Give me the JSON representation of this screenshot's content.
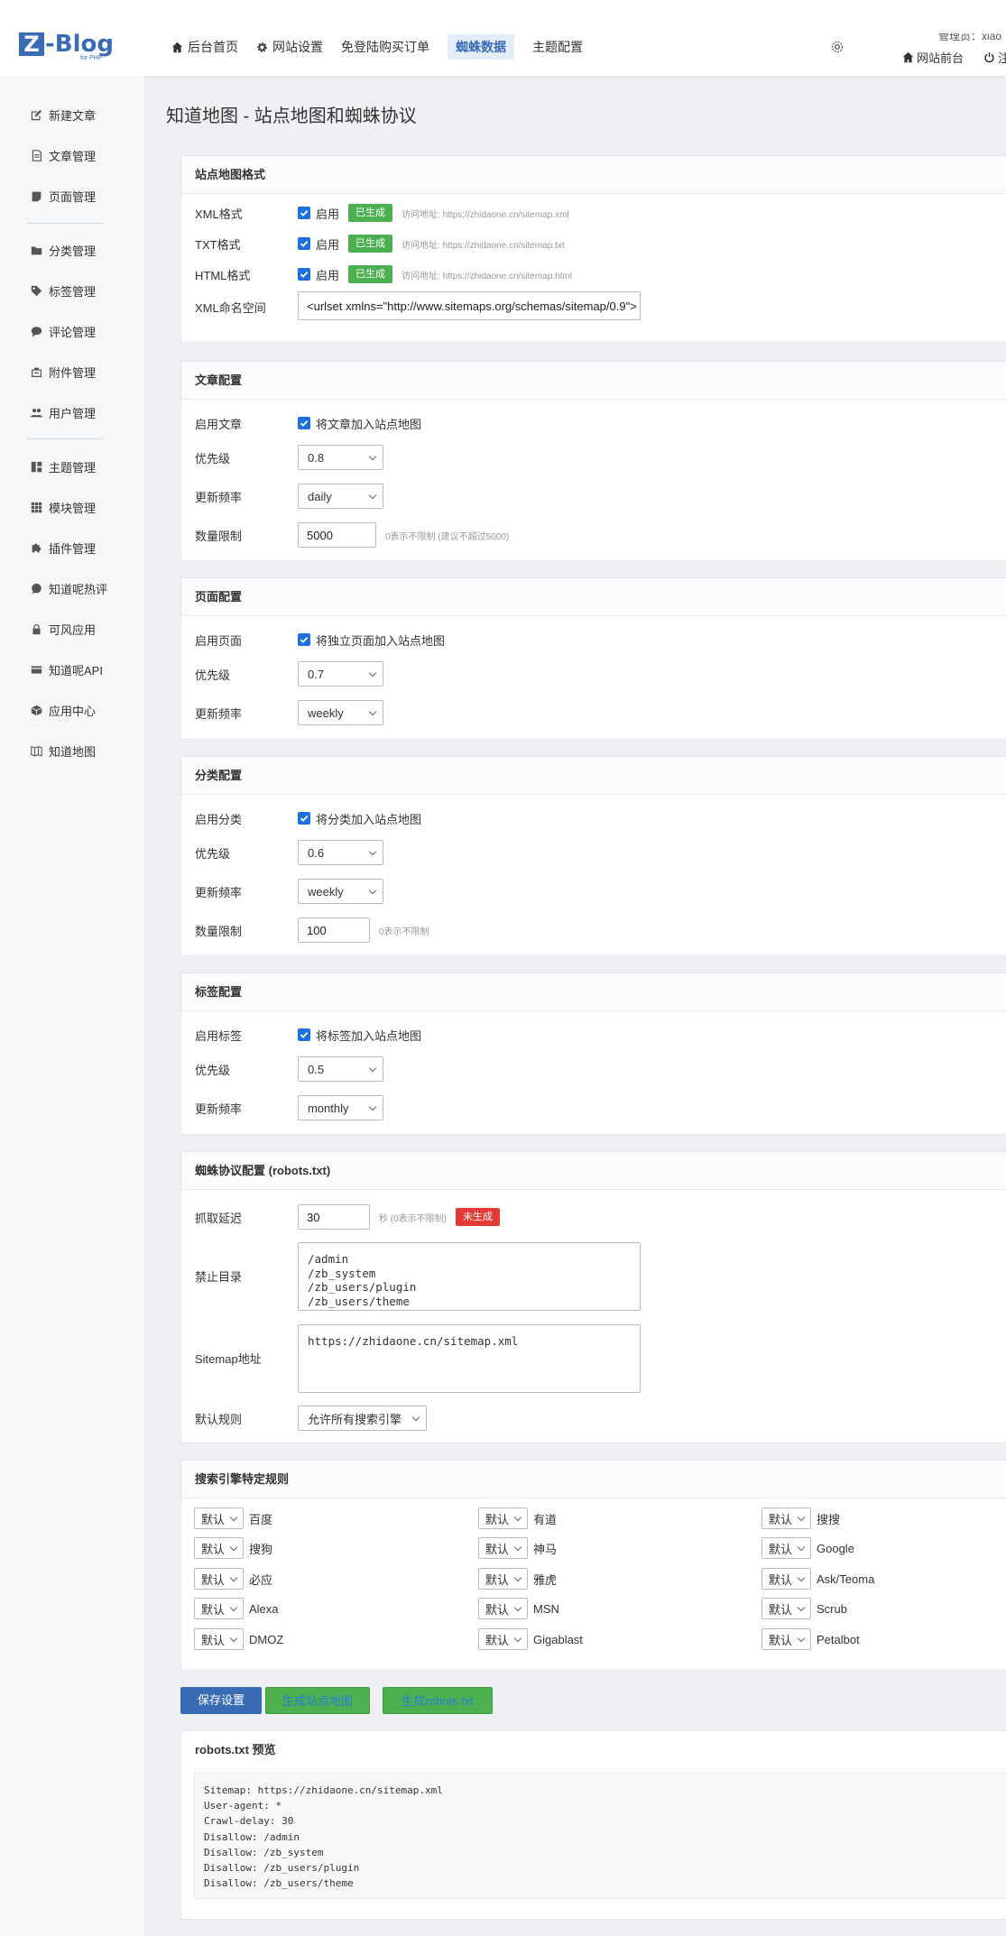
{
  "header": {
    "logo_text": "Z-Blog",
    "logo_sub": "for PHP",
    "nav": [
      "后台首页",
      "网站设置",
      "免登陆购买订单",
      "蜘蛛数据",
      "主题配置"
    ],
    "user_line": "管理员：xiao",
    "front_link": "网站前台",
    "logout_link": "注"
  },
  "sidebar": {
    "items": [
      "新建文章",
      "文章管理",
      "页面管理",
      "分类管理",
      "标签管理",
      "评论管理",
      "附件管理",
      "用户管理",
      "主题管理",
      "模块管理",
      "插件管理",
      "知道呢热评",
      "可风应用",
      "知道呢API",
      "应用中心",
      "知道地图"
    ]
  },
  "page_title": "知道地图 - 站点地图和蜘蛛协议",
  "sitemap_format": {
    "heading": "站点地图格式",
    "rows": [
      {
        "label": "XML格式",
        "check": "启用",
        "badge": "已生成",
        "hint": "访问地址: https://zhidaone.cn/sitemap.xml"
      },
      {
        "label": "TXT格式",
        "check": "启用",
        "badge": "已生成",
        "hint": "访问地址: https://zhidaone.cn/sitemap.txt"
      },
      {
        "label": "HTML格式",
        "check": "启用",
        "badge": "已生成",
        "hint": "访问地址: https://zhidaone.cn/sitemap.html"
      }
    ],
    "ns_label": "XML命名空间",
    "ns_value": "<urlset xmlns=\"http://www.sitemaps.org/schemas/sitemap/0.9\">"
  },
  "article": {
    "heading": "文章配置",
    "enable_label": "启用文章",
    "enable_text": "将文章加入站点地图",
    "priority_label": "优先级",
    "priority": "0.8",
    "freq_label": "更新频率",
    "freq": "daily",
    "limit_label": "数量限制",
    "limit": "5000",
    "limit_hint": "0表示不限制 (建议不超过5000)"
  },
  "page": {
    "heading": "页面配置",
    "enable_label": "启用页面",
    "enable_text": "将独立页面加入站点地图",
    "priority_label": "优先级",
    "priority": "0.7",
    "freq_label": "更新频率",
    "freq": "weekly"
  },
  "category": {
    "heading": "分类配置",
    "enable_label": "启用分类",
    "enable_text": "将分类加入站点地图",
    "priority_label": "优先级",
    "priority": "0.6",
    "freq_label": "更新频率",
    "freq": "weekly",
    "limit_label": "数量限制",
    "limit": "100",
    "limit_hint": "0表示不限制"
  },
  "tag": {
    "heading": "标签配置",
    "enable_label": "启用标签",
    "enable_text": "将标签加入站点地图",
    "priority_label": "优先级",
    "priority": "0.5",
    "freq_label": "更新频率",
    "freq": "monthly"
  },
  "robots": {
    "heading": "蜘蛛协议配置 (robots.txt)",
    "delay_label": "抓取延迟",
    "delay": "30",
    "delay_hint": "秒 (0表示不限制)",
    "badge": "未生成",
    "disallow_label": "禁止目录",
    "disallow": "/admin\n/zb_system\n/zb_users/plugin\n/zb_users/theme",
    "sitemap_label": "Sitemap地址",
    "sitemap": "https://zhidaone.cn/sitemap.xml",
    "default_label": "默认规则",
    "default_value": "允许所有搜索引擎"
  },
  "engines": {
    "heading": "搜索引擎特定规则",
    "default_option": "默认",
    "list": [
      "百度",
      "有道",
      "搜搜",
      "搜狗",
      "神马",
      "Google",
      "必应",
      "雅虎",
      "Ask/Teoma",
      "Alexa",
      "MSN",
      "Scrub",
      "DMOZ",
      "Gigablast",
      "Petalbot"
    ]
  },
  "buttons": {
    "save": "保存设置",
    "gen_sitemap": "生成站点地图",
    "gen_robots": "生成robots.txt"
  },
  "preview": {
    "heading": "robots.txt 预览",
    "content": "Sitemap: https://zhidaone.cn/sitemap.xml\nUser-agent: *\nCrawl-delay: 30\nDisallow: /admin\nDisallow: /zb_system\nDisallow: /zb_users/plugin\nDisallow: /zb_users/theme"
  },
  "colors": {
    "primary": "#3a6bb5",
    "success": "#4caf50",
    "danger": "#e53935",
    "checkbox": "#1e6fe0"
  }
}
